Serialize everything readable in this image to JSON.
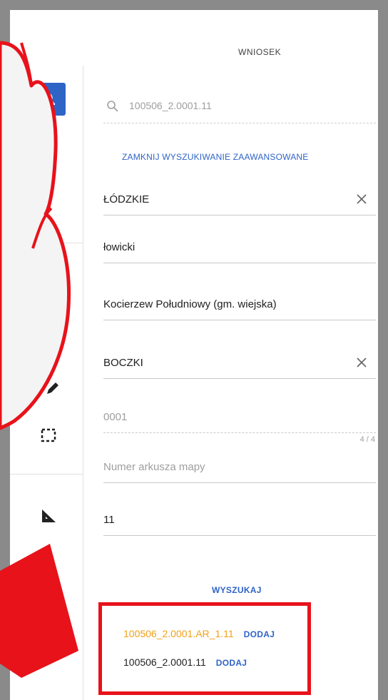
{
  "header": {
    "title": "WNIOSEK"
  },
  "search": {
    "value": "100506_2.0001.11"
  },
  "advanced_link": "ZAMKNIJ WYSZUKIWANIE ZAAWANSOWANE",
  "fields": {
    "voivodeship": "ŁÓDZKIE",
    "county": "łowicki",
    "commune": "Kocierzew Południowy (gm. wiejska)",
    "precinct": "BOCZKI",
    "precinct_number_placeholder": "0001",
    "precinct_number_counter": "4 / 4",
    "map_sheet_placeholder": "Numer arkusza mapy",
    "parcel_number": "11"
  },
  "search_button": "WYSZUKAJ",
  "results": [
    {
      "code": "100506_2.0001.AR_1.11",
      "action": "DODAJ",
      "color": "#f0a11a"
    },
    {
      "code": "100506_2.0001.11",
      "action": "DODAJ",
      "color": "#212121"
    }
  ],
  "colors": {
    "accent": "#2f64c7",
    "annotation": "#e8121b",
    "highlight_result": "#f0a11a"
  }
}
